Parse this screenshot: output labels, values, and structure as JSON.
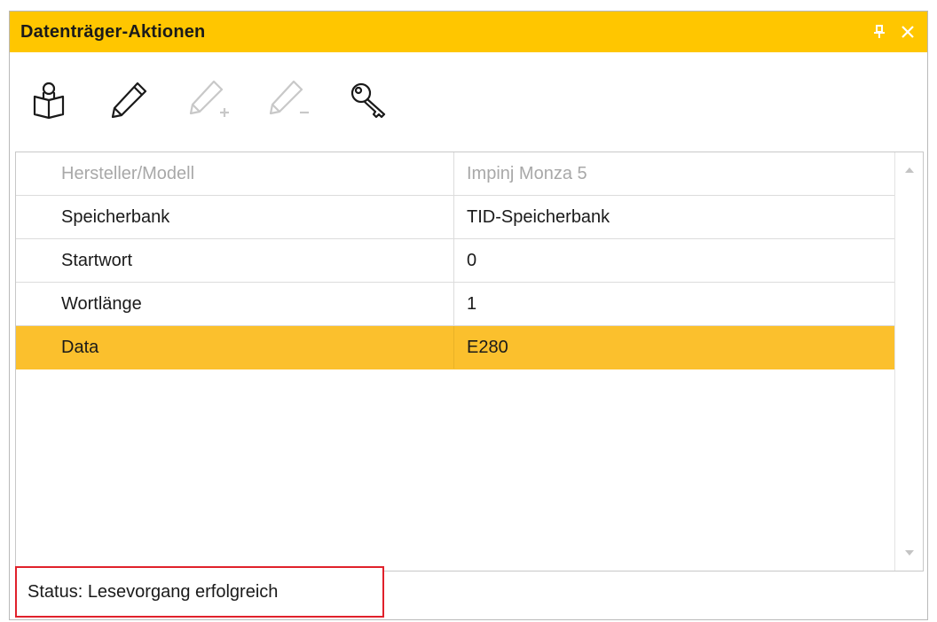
{
  "window": {
    "title": "Datenträger-Aktionen",
    "accent_color": "#ffc600",
    "pin_icon": "pin-icon",
    "close_icon": "close-icon"
  },
  "toolbar": {
    "tools": [
      {
        "icon": "read-tag-icon",
        "enabled": true
      },
      {
        "icon": "edit-pencil-icon",
        "enabled": true
      },
      {
        "icon": "pencil-plus-icon",
        "enabled": false
      },
      {
        "icon": "pencil-minus-icon",
        "enabled": false
      },
      {
        "icon": "key-icon",
        "enabled": true
      }
    ]
  },
  "properties": {
    "rows": [
      {
        "key": "Hersteller/Modell",
        "value": "Impinj Monza 5",
        "disabled": true
      },
      {
        "key": "Speicherbank",
        "value": "TID-Speicherbank"
      },
      {
        "key": "Startwort",
        "value": "0"
      },
      {
        "key": "Wortlänge",
        "value": "1"
      },
      {
        "key": "Data",
        "value": "E280",
        "selected": true
      }
    ],
    "selection_color": "#fbc02d"
  },
  "status": {
    "text": "Status: Lesevorgang erfolgreich",
    "highlight_color": "#e0212b"
  }
}
